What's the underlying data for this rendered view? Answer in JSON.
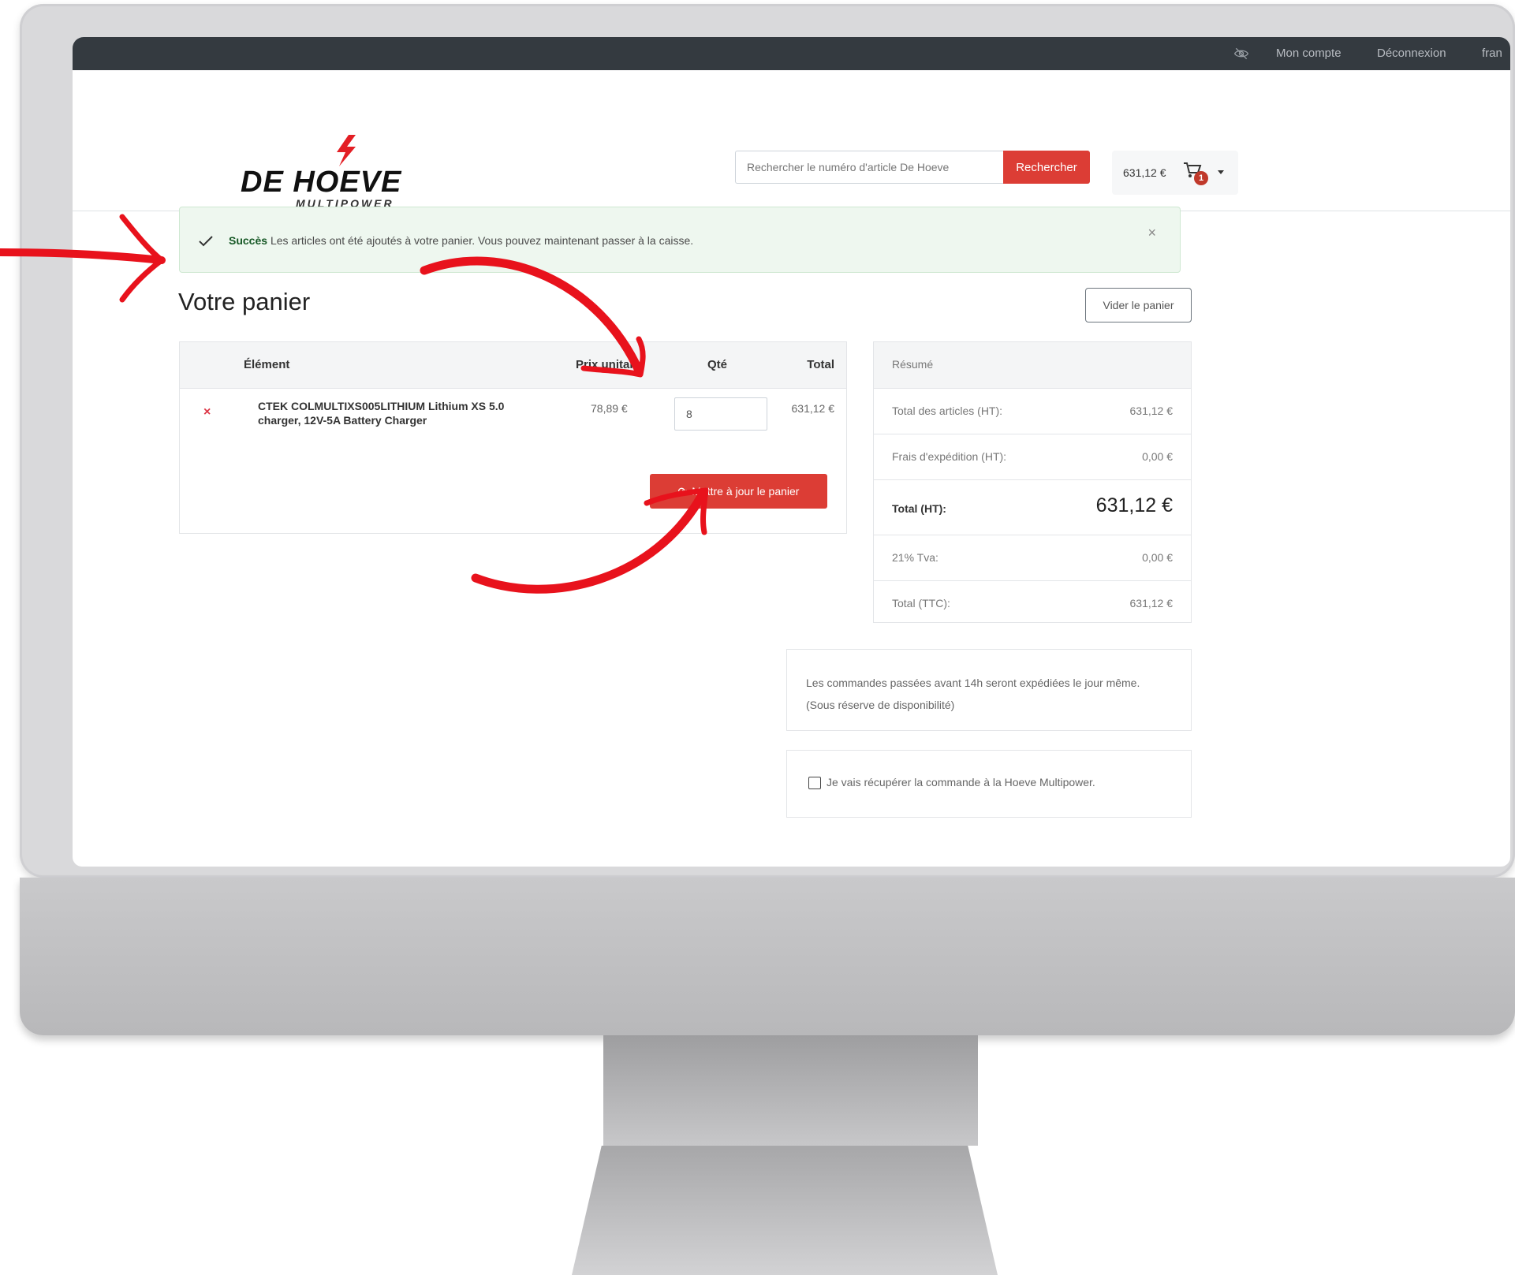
{
  "topbar": {
    "account": "Mon compte",
    "logout": "Déconnexion",
    "language": "fran"
  },
  "header": {
    "logo_text_main": "DE HOEVE",
    "logo_text_sub": "MULTIPOWER",
    "search_placeholder": "Rechercher le numéro d'article De Hoeve",
    "search_button": "Rechercher",
    "cart_total": "631,12 €",
    "cart_count": "1"
  },
  "alert": {
    "title": "Succès",
    "message": "Les articles ont été ajoutés à votre panier. Vous pouvez maintenant passer à la caisse.",
    "close": "×"
  },
  "page": {
    "title": "Votre panier",
    "clear_button": "Vider le panier"
  },
  "cart_table": {
    "headers": {
      "item": "Élément",
      "unit_price": "Prix unitaire",
      "qty": "Qté",
      "total": "Total"
    },
    "rows": [
      {
        "remove": "×",
        "name": "CTEK COLMULTIXS005LITHIUM Lithium XS 5.0 charger, 12V-5A Battery Charger",
        "unit_price": "78,89 €",
        "qty": "8",
        "total": "631,12 €"
      }
    ],
    "update_button": "Mettre à jour le panier"
  },
  "summary": {
    "title": "Résumé",
    "rows": [
      {
        "label": "Total des articles (HT):",
        "value": "631,12 €"
      },
      {
        "label": "Frais d'expédition (HT):",
        "value": "0,00 €"
      },
      {
        "label": "Total (HT):",
        "value": "631,12 €"
      },
      {
        "label": "21% Tva:",
        "value": "0,00 €"
      },
      {
        "label": "Total (TTC):",
        "value": "631,12 €"
      }
    ]
  },
  "shipping_note": "Les commandes passées avant 14h seront expédiées le jour même. (Sous réserve de disponibilité)",
  "pickup_label": "Je vais récupérer la commande à la Hoeve Multipower.",
  "colors": {
    "accent": "#dc3d35",
    "topbar": "#343a40",
    "success_bg": "#eef7ef",
    "annotation": "#e8121c"
  }
}
